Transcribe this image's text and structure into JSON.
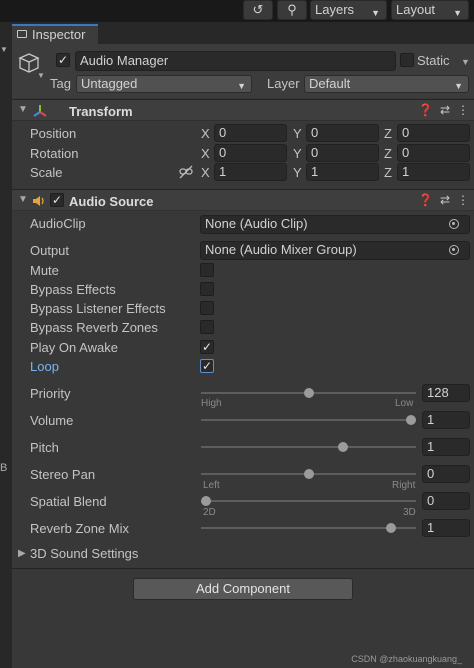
{
  "toolbar": {
    "history_icon": "history-icon",
    "search_icon": "search-icon",
    "layers_label": "Layers",
    "layout_label": "Layout"
  },
  "tab": {
    "label": "Inspector"
  },
  "gameobject": {
    "name": "Audio Manager",
    "static_label": "Static",
    "tag_label": "Tag",
    "tag_value": "Untagged",
    "layer_label": "Layer",
    "layer_value": "Default"
  },
  "transform": {
    "title": "Transform",
    "rows": [
      {
        "label": "Position",
        "x": "0",
        "y": "0",
        "z": "0"
      },
      {
        "label": "Rotation",
        "x": "0",
        "y": "0",
        "z": "0"
      },
      {
        "label": "Scale",
        "x": "1",
        "y": "1",
        "z": "1"
      }
    ],
    "axis_x": "X",
    "axis_y": "Y",
    "axis_z": "Z"
  },
  "audio_source": {
    "title": "Audio Source",
    "audioclip_label": "AudioClip",
    "audioclip_value": "None (Audio Clip)",
    "output_label": "Output",
    "output_value": "None (Audio Mixer Group)",
    "mute_label": "Mute",
    "bypass_effects_label": "Bypass Effects",
    "bypass_listener_label": "Bypass Listener Effects",
    "bypass_reverb_label": "Bypass Reverb Zones",
    "play_on_awake_label": "Play On Awake",
    "loop_label": "Loop",
    "mute": false,
    "bypass_effects": false,
    "bypass_listener": false,
    "bypass_reverb": false,
    "play_on_awake": true,
    "loop": true,
    "priority_label": "Priority",
    "priority_value": "128",
    "priority_fraction": 0.5,
    "priority_low_left": "High",
    "priority_low_right": "Low",
    "volume_label": "Volume",
    "volume_value": "1",
    "volume_fraction": 1.0,
    "pitch_label": "Pitch",
    "pitch_value": "1",
    "pitch_fraction": 0.67,
    "stereo_pan_label": "Stereo Pan",
    "stereo_pan_value": "0",
    "stereo_pan_fraction": 0.5,
    "stereo_left": "Left",
    "stereo_right": "Right",
    "spatial_blend_label": "Spatial Blend",
    "spatial_blend_value": "0",
    "spatial_blend_fraction": 0.0,
    "spatial_2d": "2D",
    "spatial_3d": "3D",
    "reverb_mix_label": "Reverb Zone Mix",
    "reverb_mix_value": "1",
    "reverb_mix_fraction": 0.9,
    "sound_settings_label": "3D Sound Settings"
  },
  "add_component_label": "Add Component",
  "watermark": "CSDN @zhaokuangkuang_",
  "colors": {
    "accent": "#3a79bb",
    "loop_label": "#7ab4f0"
  }
}
